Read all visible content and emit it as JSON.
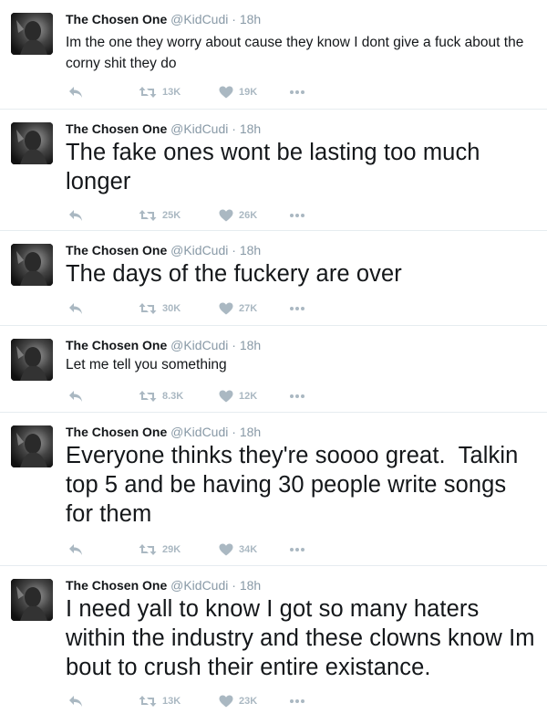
{
  "tweets": [
    {
      "name": "The Chosen One",
      "handle": "@KidCudi",
      "separator": "·",
      "time": "18h",
      "text": "Im the one they worry about cause they know I dont give a fuck about the corny shit they do",
      "retweets": "13K",
      "likes": "19K"
    },
    {
      "name": "The Chosen One",
      "handle": "@KidCudi",
      "separator": "·",
      "time": "18h",
      "text": "The fake ones wont be lasting too much longer",
      "retweets": "25K",
      "likes": "26K"
    },
    {
      "name": "The Chosen One",
      "handle": "@KidCudi",
      "separator": "·",
      "time": "18h",
      "text": "The days of the fuckery are over",
      "retweets": "30K",
      "likes": "27K"
    },
    {
      "name": "The Chosen One",
      "handle": "@KidCudi",
      "separator": "·",
      "time": "18h",
      "text": "Let me tell you something",
      "retweets": "8.3K",
      "likes": "12K"
    },
    {
      "name": "The Chosen One",
      "handle": "@KidCudi",
      "separator": "·",
      "time": "18h",
      "text": "Everyone thinks they're soooo great.  Talkin top 5 and be having 30 people write songs for them",
      "retweets": "29K",
      "likes": "34K"
    },
    {
      "name": "The Chosen One",
      "handle": "@KidCudi",
      "separator": "·",
      "time": "18h",
      "text": "I need yall to know I got so many haters within the industry and these clowns know Im bout to crush their entire existance.",
      "retweets": "13K",
      "likes": "23K"
    }
  ],
  "icons": {
    "reply": "reply-arrow-icon",
    "retweet": "retweet-icon",
    "like": "heart-icon",
    "more": "more-dots-icon"
  },
  "colors": {
    "text": "#14171a",
    "secondary": "#8899a6",
    "action_icon": "#aab8c2",
    "divider": "#e6ecf0"
  }
}
